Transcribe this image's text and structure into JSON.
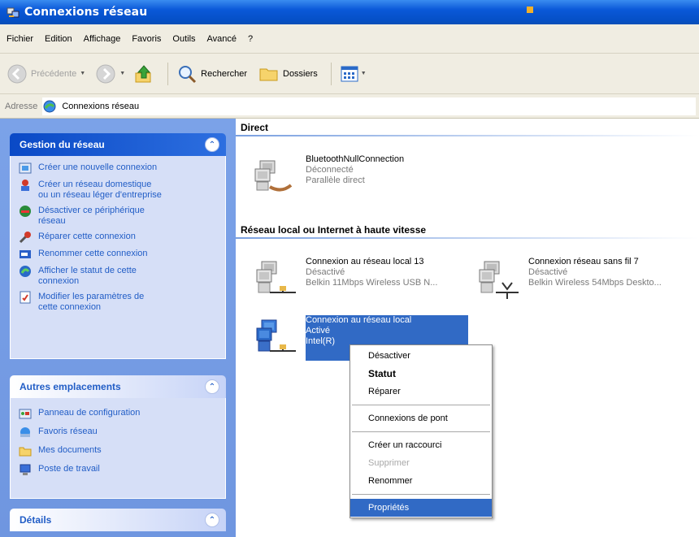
{
  "window": {
    "title": "Connexions réseau"
  },
  "menu": [
    "Fichier",
    "Edition",
    "Affichage",
    "Favoris",
    "Outils",
    "Avancé",
    "?"
  ],
  "toolbar": {
    "back_label": "Précédente",
    "search_label": "Rechercher",
    "folders_label": "Dossiers"
  },
  "address": {
    "label": "Adresse",
    "value": "Connexions réseau"
  },
  "sidebar": {
    "panels": [
      {
        "title": "Gestion du réseau",
        "items": [
          "Créer une nouvelle connexion",
          "Créer un réseau domestique\nou un réseau léger d'entreprise",
          "Désactiver ce périphérique\nréseau",
          "Réparer cette connexion",
          "Renommer cette connexion",
          "Afficher le statut de cette\nconnexion",
          "Modifier les paramètres de\ncette connexion"
        ]
      },
      {
        "title": "Autres emplacements",
        "items": [
          "Panneau de configuration",
          "Favoris réseau",
          "Mes documents",
          "Poste de travail"
        ]
      },
      {
        "title": "Détails",
        "items": []
      }
    ]
  },
  "groups": {
    "direct": {
      "title": "Direct",
      "connections": [
        {
          "name": "BluetoothNullConnection",
          "status": "Déconnecté",
          "device": "Parallèle direct"
        }
      ]
    },
    "lan": {
      "title": "Réseau local ou Internet à haute vitesse",
      "connections": [
        {
          "name": "Connexion au réseau local 13",
          "status": "Désactivé",
          "device": "Belkin 11Mbps Wireless USB N..."
        },
        {
          "name": "Connexion réseau sans fil 7",
          "status": "Désactivé",
          "device": "Belkin Wireless 54Mbps Deskto..."
        },
        {
          "name": "Connexion au réseau local",
          "status": "Activé",
          "device": "Intel(R)"
        }
      ]
    }
  },
  "context_menu": {
    "items": [
      "Désactiver",
      "Statut",
      "Réparer",
      "Connexions de pont",
      "Créer un raccourci",
      "Supprimer",
      "Renommer",
      "Propriétés"
    ]
  },
  "colors": {
    "title_bar": "#0a58d8",
    "sidebar": "#6f96e0",
    "selection": "#316ac5",
    "link": "#215dc6"
  }
}
